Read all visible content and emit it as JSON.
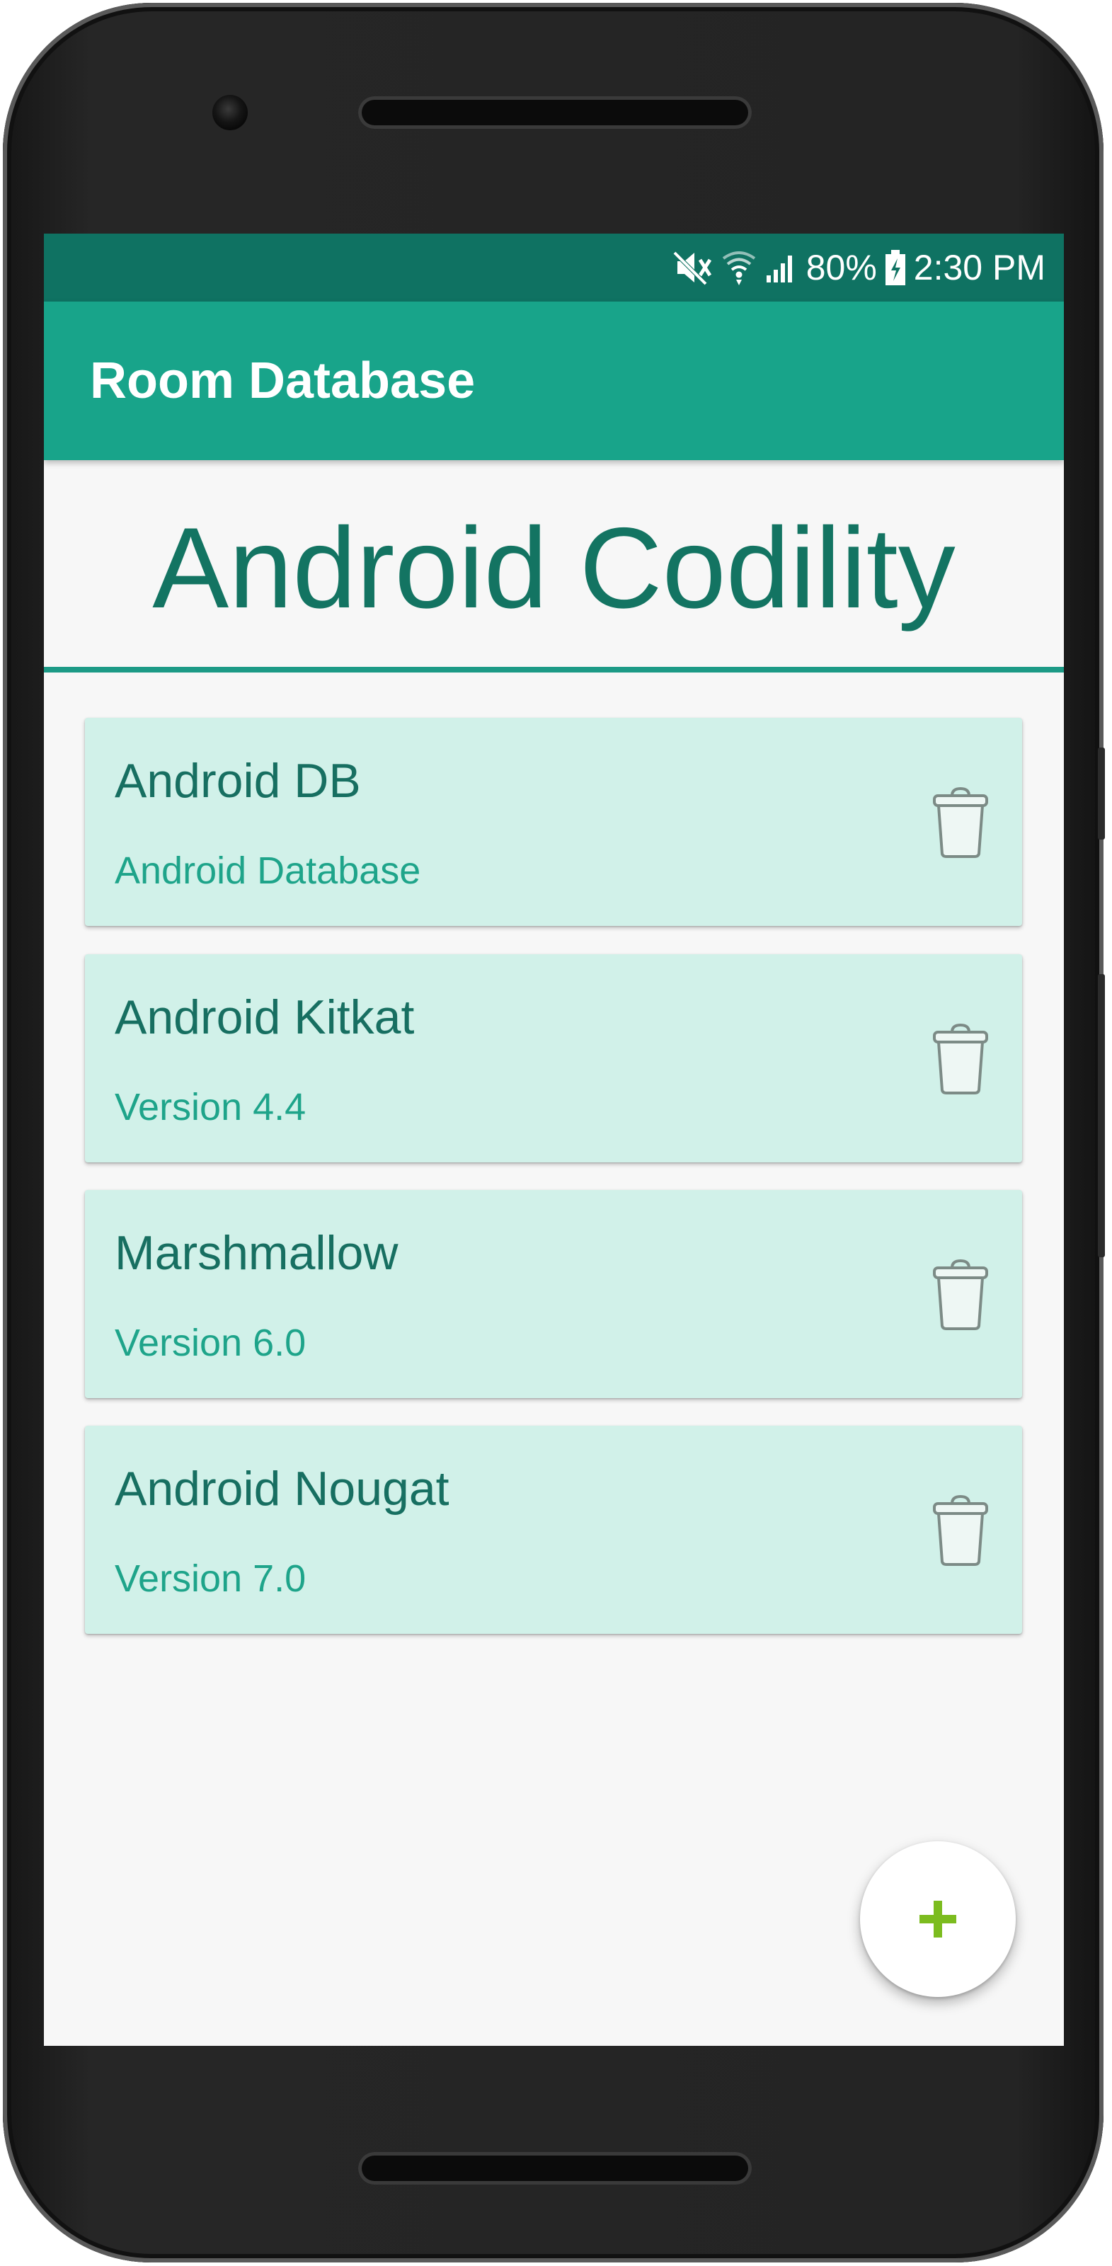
{
  "status_bar": {
    "battery": "80%",
    "time": "2:30 PM",
    "icons": [
      "mute-vibrate-icon",
      "wifi-icon",
      "signal-icon",
      "battery-charging-icon"
    ]
  },
  "app_bar": {
    "title": "Room Database"
  },
  "header": {
    "title": "Android Codility"
  },
  "items": [
    {
      "title": "Android DB",
      "subtitle": "Android Database"
    },
    {
      "title": "Android Kitkat",
      "subtitle": "Version 4.4"
    },
    {
      "title": "Marshmallow",
      "subtitle": "Version 6.0"
    },
    {
      "title": "Android Nougat",
      "subtitle": "Version 7.0"
    }
  ],
  "fab": {
    "icon": "plus-icon"
  },
  "colors": {
    "status_bar": "#0f7262",
    "app_bar": "#18a48a",
    "card_bg": "#d1f1e9",
    "card_title": "#176f61",
    "card_subtitle": "#1ea48a",
    "fab_plus": "#7cbc1f"
  }
}
